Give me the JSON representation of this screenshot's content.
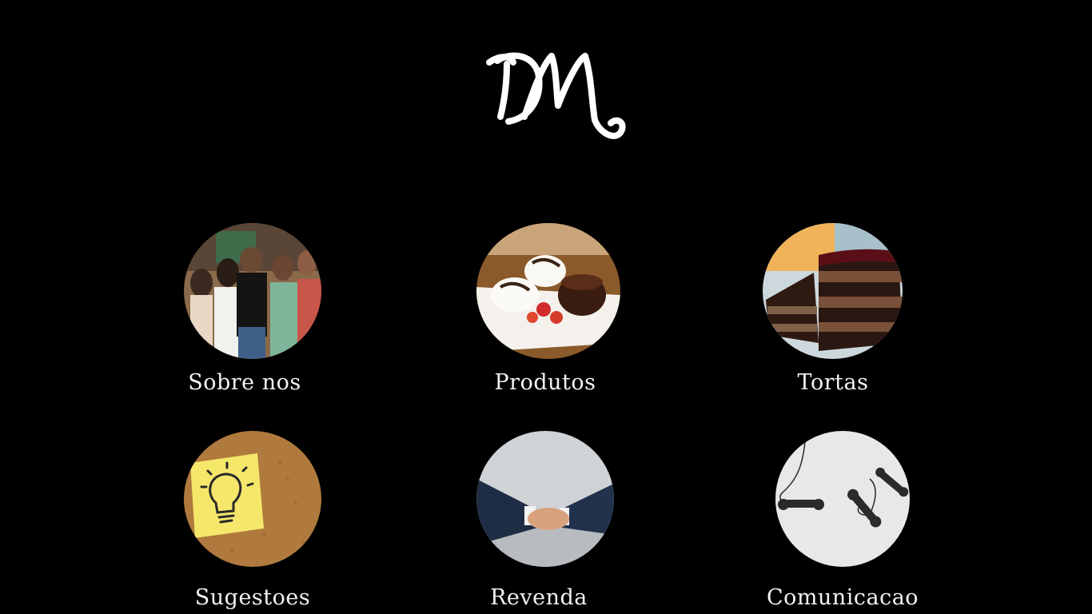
{
  "brand": {
    "logo_text": "DM",
    "logo_icon": "dm-script-logo"
  },
  "menu": [
    {
      "label": "Sobre nos",
      "icon": "team-photo"
    },
    {
      "label": "Produtos",
      "icon": "dessert-plate-photo"
    },
    {
      "label": "Tortas",
      "icon": "chocolate-cake-photo"
    },
    {
      "label": "Sugestoes",
      "icon": "lightbulb-note-photo"
    },
    {
      "label": "Revenda",
      "icon": "handshake-photo"
    },
    {
      "label": "Comunicacao",
      "icon": "telephones-photo"
    }
  ],
  "colors": {
    "background": "#000000",
    "text": "#f2f2f2"
  }
}
